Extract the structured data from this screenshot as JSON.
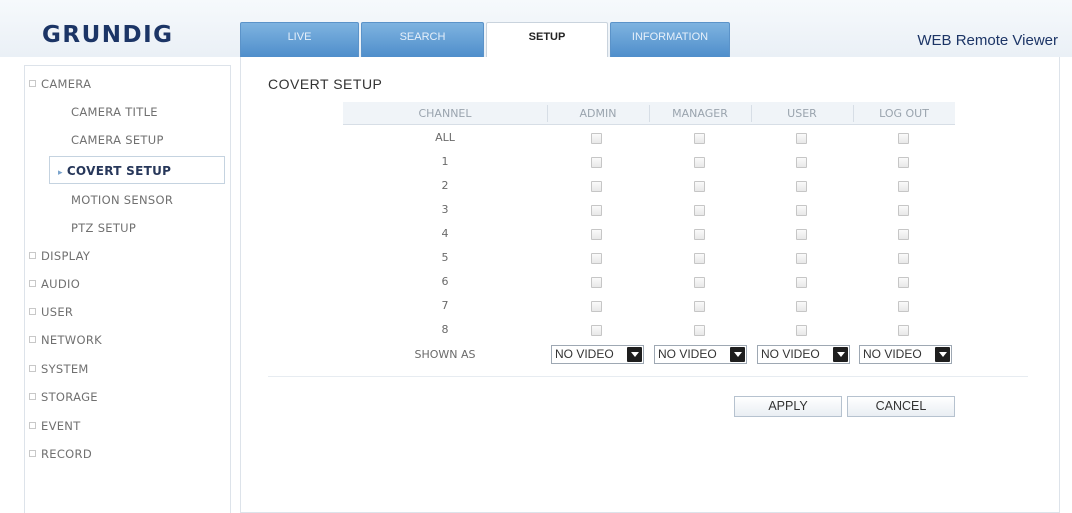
{
  "logo": "GRUNDIG",
  "viewer_title": "WEB Remote Viewer",
  "tabs": [
    {
      "label": "LIVE",
      "active": false
    },
    {
      "label": "SEARCH",
      "active": false
    },
    {
      "label": "SETUP",
      "active": true
    },
    {
      "label": "INFORMATION",
      "active": false
    }
  ],
  "sidebar": {
    "camera": "CAMERA",
    "camera_sub": [
      "CAMERA TITLE",
      "CAMERA SETUP",
      "COVERT SETUP",
      "MOTION SENSOR",
      "PTZ SETUP"
    ],
    "active_sub": "COVERT SETUP",
    "groups": [
      "DISPLAY",
      "AUDIO",
      "USER",
      "NETWORK",
      "SYSTEM",
      "STORAGE",
      "EVENT",
      "RECORD"
    ]
  },
  "page_title": "COVERT SETUP",
  "table": {
    "headers": [
      "CHANNEL",
      "ADMIN",
      "MANAGER",
      "USER",
      "LOG OUT"
    ],
    "rows": [
      "ALL",
      "1",
      "2",
      "3",
      "4",
      "5",
      "6",
      "7",
      "8"
    ],
    "shown_as_label": "SHOWN AS",
    "shown_as_values": [
      "NO VIDEO",
      "NO VIDEO",
      "NO VIDEO",
      "NO VIDEO"
    ]
  },
  "buttons": {
    "apply": "APPLY",
    "cancel": "CANCEL"
  },
  "colors": {
    "brand": "#1c3566",
    "tab": "#5b93c9"
  }
}
